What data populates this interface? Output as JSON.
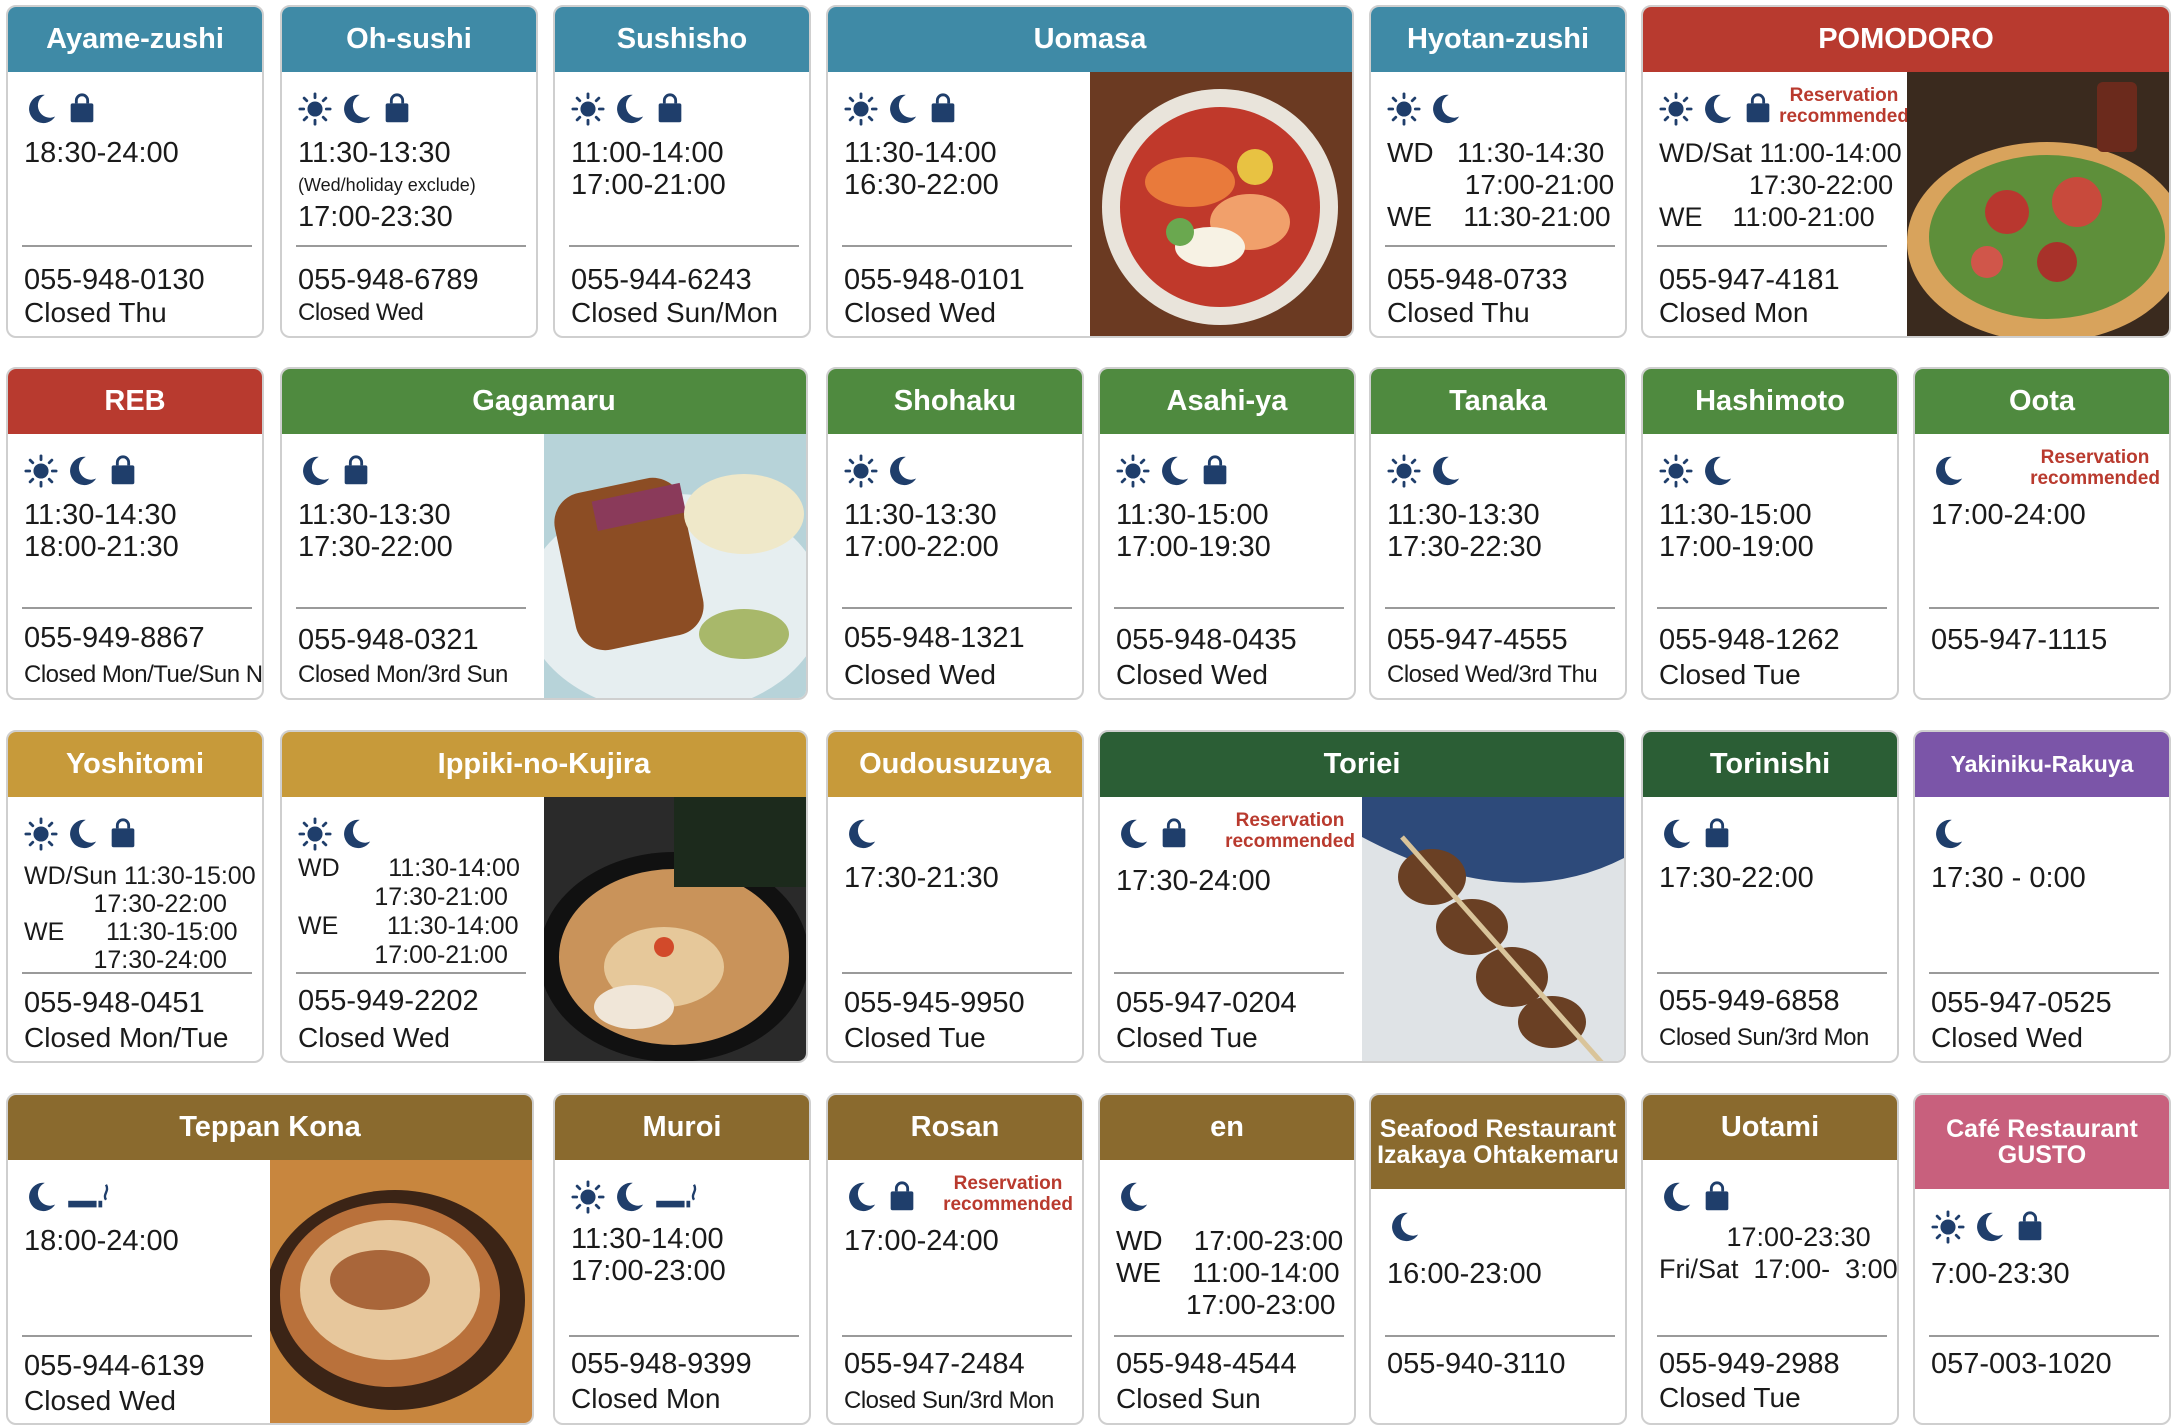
{
  "colors": {
    "teal": "#3f8aa6",
    "red": "#b83a2f",
    "green": "#4f8a3f",
    "dark_green": "#2b5e35",
    "gold": "#c79a3a",
    "brown": "#8a6a2e",
    "purple": "#7b55a8",
    "pink": "#c8607d",
    "icon": "#1f3e6b",
    "reservation_text": "#b93a2e"
  },
  "icon_legend": [
    "sun-icon",
    "moon-icon",
    "takeout-bag-icon",
    "smoking-icon"
  ],
  "reservation_label": "Reservation recommended",
  "restaurants": {
    "ayame": {
      "name": "Ayame-zushi",
      "hours": "18:30-24:00",
      "phone": "055-948-0130",
      "closed": "Closed Thu"
    },
    "ohsushi": {
      "name": "Oh-sushi",
      "hours1": "11:30-13:30",
      "note": "(Wed/holiday exclude)",
      "hours2": "17:00-23:30",
      "phone": "055-948-6789",
      "closed": "Closed Wed"
    },
    "sushisho": {
      "name": "Sushisho",
      "hours": "11:00-14:00\n17:00-21:00",
      "phone": "055-944-6243",
      "closed": "Closed Sun/Mon"
    },
    "uomasa": {
      "name": "Uomasa",
      "hours": "11:30-14:00\n16:30-22:00",
      "phone": "055-948-0101",
      "closed": "Closed Wed"
    },
    "hyotan": {
      "name": "Hyotan-zushi",
      "hours": "WD   11:30-14:30\n          17:00-21:00\nWE    11:30-21:00",
      "phone": "055-948-0733",
      "closed": "Closed Thu"
    },
    "pomodoro": {
      "name": "POMODORO",
      "hours": "WD/Sat 11:00-14:00\n            17:30-22:00\nWE    11:00-21:00",
      "phone": "055-947-4181",
      "closed": "Closed Mon"
    },
    "reb": {
      "name": "REB",
      "hours": "11:30-14:30\n18:00-21:30",
      "phone": "055-949-8867",
      "closed": "Closed Mon/Tue/Sun Night"
    },
    "gagamaru": {
      "name": "Gagamaru",
      "hours": "11:30-13:30\n17:30-22:00",
      "phone": "055-948-0321",
      "closed": "Closed Mon/3rd Sun"
    },
    "shohaku": {
      "name": "Shohaku",
      "hours": "11:30-13:30\n17:00-22:00",
      "phone": "055-948-1321",
      "closed": "Closed Wed"
    },
    "asahiya": {
      "name": "Asahi-ya",
      "hours": "11:30-15:00\n17:00-19:30",
      "phone": "055-948-0435",
      "closed": "Closed Wed"
    },
    "tanaka": {
      "name": "Tanaka",
      "hours": "11:30-13:30\n17:30-22:30",
      "phone": "055-947-4555",
      "closed": "Closed Wed/3rd Thu"
    },
    "hashimoto": {
      "name": "Hashimoto",
      "hours": "11:30-15:00\n17:00-19:00",
      "phone": "055-948-1262",
      "closed": "Closed Tue"
    },
    "oota": {
      "name": "Oota",
      "hours": "17:00-24:00",
      "phone": "055-947-1115"
    },
    "yoshitomi": {
      "name": "Yoshitomi",
      "hours": "WD/Sun 11:30-15:00\n          17:30-22:00\nWE      11:30-15:00\n          17:30-24:00",
      "phone": "055-948-0451",
      "closed": "Closed Mon/Tue"
    },
    "ippiki": {
      "name": "Ippiki-no-Kujira",
      "hours": "WD       11:30-14:00\n           17:30-21:00\nWE       11:30-14:00\n           17:00-21:00",
      "phone": "055-949-2202",
      "closed": "Closed Wed"
    },
    "oudou": {
      "name": "Oudousuzuya",
      "hours": "17:30-21:30",
      "phone": "055-945-9950",
      "closed": "Closed Tue"
    },
    "toriei": {
      "name": "Toriei",
      "hours": "17:30-24:00",
      "phone": "055-947-0204",
      "closed": "Closed Tue"
    },
    "torinishi": {
      "name": "Torinishi",
      "hours": "17:30-22:00",
      "phone": "055-949-6858",
      "closed": "Closed Sun/3rd Mon"
    },
    "rakuya": {
      "name": "Yakiniku-Rakuya",
      "hours": "17:30 - 0:00",
      "phone": "055-947-0525",
      "closed": "Closed Wed"
    },
    "teppan": {
      "name": "Teppan Kona",
      "hours": "18:00-24:00",
      "phone": "055-944-6139",
      "closed": "Closed Wed"
    },
    "muroi": {
      "name": "Muroi",
      "hours": "11:30-14:00\n17:00-23:00",
      "phone": "055-948-9399",
      "closed": "Closed Mon"
    },
    "rosan": {
      "name": "Rosan",
      "hours": "17:00-24:00",
      "phone": "055-947-2484",
      "closed": "Closed Sun/3rd Mon"
    },
    "en": {
      "name": "en",
      "hours": "WD    17:00-23:00\nWE    11:00-14:00\n         17:00-23:00",
      "phone": "055-948-4544",
      "closed": "Closed Sun"
    },
    "ohtakemaru": {
      "name": "Seafood Restaurant\nIzakaya Ohtakemaru",
      "hours": "16:00-23:00",
      "phone": "055-940-3110"
    },
    "uotami": {
      "name": "Uotami",
      "hours": "         17:00-23:30\nFri/Sat  17:00-  3:00",
      "phone": "055-949-2988",
      "closed": "Closed Tue"
    },
    "gusto": {
      "name": "Café Restaurant\nGUSTO",
      "hours": "7:00-23:30",
      "phone": "057-003-1020"
    }
  }
}
